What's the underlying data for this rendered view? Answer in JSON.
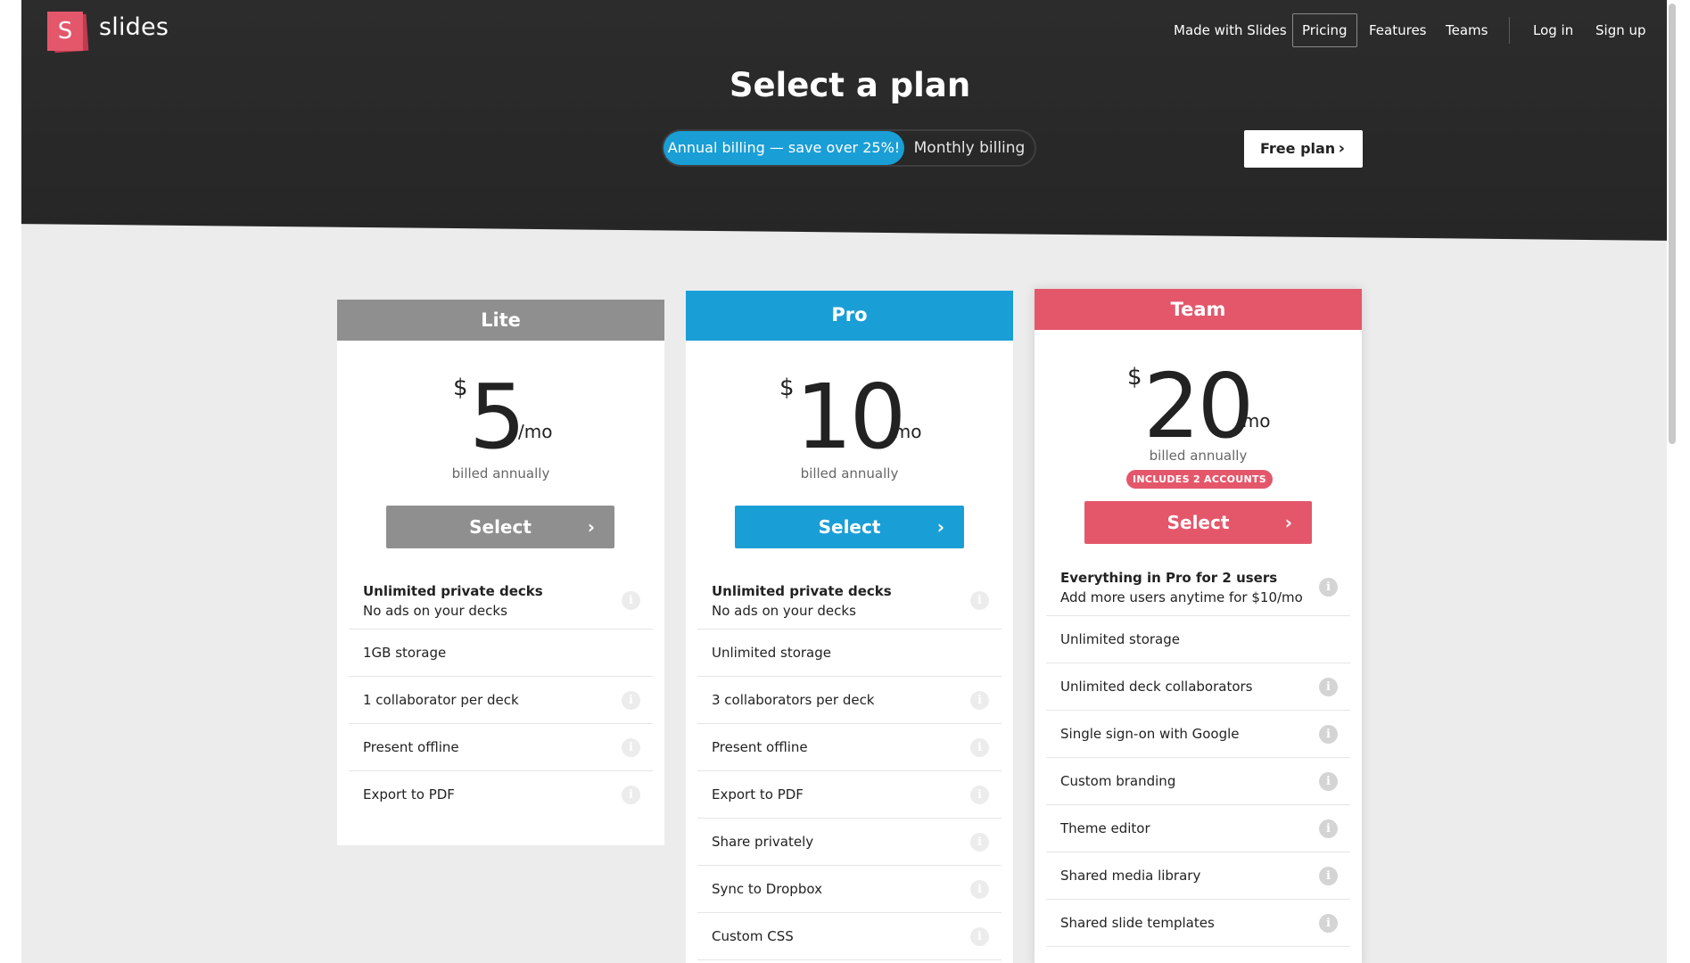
{
  "brand": {
    "logo_letter": "S",
    "name": "slides",
    "accent": "#e4576b"
  },
  "nav": {
    "made_with": "Made with Slides",
    "pricing": "Pricing",
    "features": "Features",
    "teams": "Teams",
    "login": "Log in",
    "signup": "Sign up"
  },
  "title": "Select a plan",
  "billing": {
    "annual": "Annual billing — save over 25%!",
    "monthly": "Monthly billing",
    "selected": "annual",
    "accent": "#1a9ed6"
  },
  "free_plan": {
    "label": "Free plan",
    "icon": "chevron-right-icon"
  },
  "plans": [
    {
      "name": "Lite",
      "color": "#8f8f8f",
      "currency": "$",
      "price": "5",
      "unit": "/mo",
      "billed": "billed annually",
      "select": "Select",
      "features": [
        {
          "line1": "Unlimited private decks",
          "line2": "No ads on your decks",
          "info": true
        },
        {
          "line1": "1GB storage",
          "info": false
        },
        {
          "line1": "1 collaborator per deck",
          "info": true
        },
        {
          "line1": "Present offline",
          "info": true
        },
        {
          "line1": "Export to PDF",
          "info": true
        }
      ]
    },
    {
      "name": "Pro",
      "color": "#1a9ed6",
      "currency": "$",
      "price": "10",
      "unit": "/mo",
      "billed": "billed annually",
      "select": "Select",
      "features": [
        {
          "line1": "Unlimited private decks",
          "line2": "No ads on your decks",
          "info": true
        },
        {
          "line1": "Unlimited storage",
          "info": false
        },
        {
          "line1": "3 collaborators per deck",
          "info": true
        },
        {
          "line1": "Present offline",
          "info": true
        },
        {
          "line1": "Export to PDF",
          "info": true
        },
        {
          "line1": "Share privately",
          "info": true
        },
        {
          "line1": "Sync to Dropbox",
          "info": true
        },
        {
          "line1": "Custom CSS",
          "info": true
        }
      ]
    },
    {
      "name": "Team",
      "color": "#e4576b",
      "currency": "$",
      "price": "20",
      "unit": "/mo",
      "billed": "billed annually",
      "badge": "INCLUDES 2 ACCOUNTS",
      "select": "Select",
      "features": [
        {
          "line1": "Everything in Pro for 2 users",
          "line2": "Add more users anytime for $10/mo",
          "info": true
        },
        {
          "line1": "Unlimited storage",
          "info": false
        },
        {
          "line1": "Unlimited deck collaborators",
          "info": true
        },
        {
          "line1": "Single sign-on with Google",
          "info": true
        },
        {
          "line1": "Custom branding",
          "info": true
        },
        {
          "line1": "Theme editor",
          "info": true
        },
        {
          "line1": "Shared media library",
          "info": true
        },
        {
          "line1": "Shared slide templates",
          "info": true
        }
      ]
    }
  ]
}
